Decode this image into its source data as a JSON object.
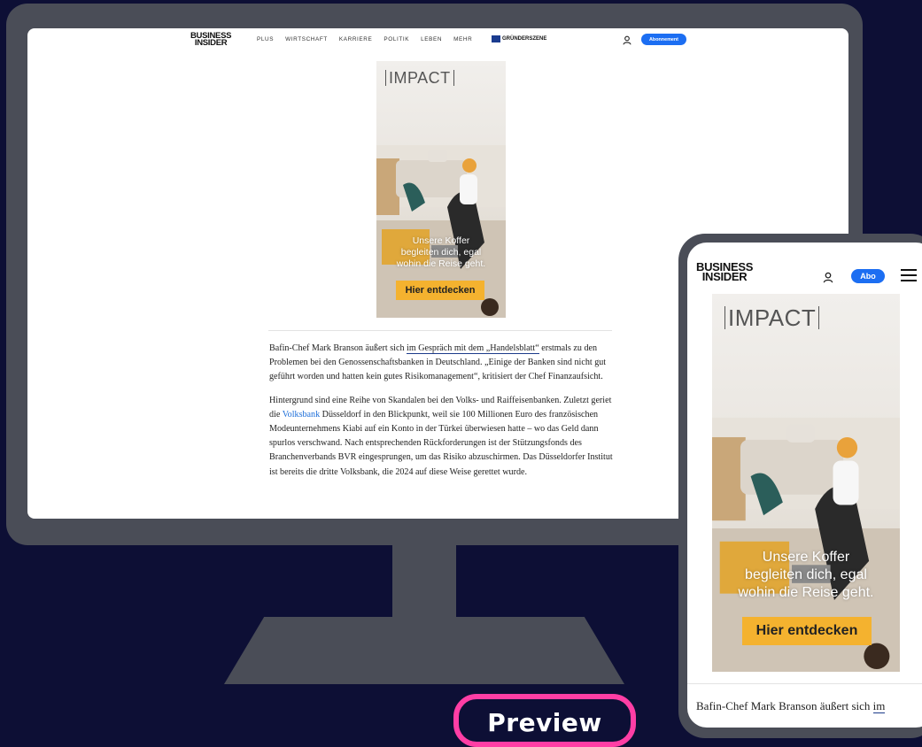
{
  "brand": {
    "logo_line1": "BUSINESS",
    "logo_line2": "INSIDER",
    "partner_logo": "GRÜNDERSZENE"
  },
  "nav": {
    "items": [
      {
        "label": "PLUS"
      },
      {
        "label": "WIRTSCHAFT"
      },
      {
        "label": "KARRIERE"
      },
      {
        "label": "POLITIK"
      },
      {
        "label": "LEBEN"
      },
      {
        "label": "MEHR"
      }
    ]
  },
  "header": {
    "subscribe_desktop": "Abonnement",
    "subscribe_mobile": "Abo",
    "user_icon": "user-icon",
    "menu_icon": "hamburger-menu-icon"
  },
  "ad": {
    "brand": "IMPACT",
    "copy_line1": "Unsere Koffer",
    "copy_line2": "begleiten dich, egal",
    "copy_line3": "wohin die Reise geht.",
    "cta": "Hier entdecken"
  },
  "article": {
    "p1_before": "Bafin-Chef Mark Branson äußert sich ",
    "p1_link": "im Gespräch mit dem „Handelsblatt“",
    "p1_after": " erstmals zu den Problemen bei den Genossenschaftsbanken in Deutschland. „Einige der Banken sind nicht gut geführt worden und hatten kein gutes Risikomanagement“, kritisiert der Chef Finanzaufsicht.",
    "p2_before": "Hintergrund sind eine Reihe von Skandalen bei den Volks- und Raiffeisenbanken. Zuletzt geriet die ",
    "p2_link": "Volksbank",
    "p2_after": " Düsseldorf in den Blickpunkt, weil sie 100 Millionen Euro des französischen Modeunternehmens Kiabi auf ein Konto in der Türkei überwiesen hatte – wo das Geld dann spurlos verschwand. Nach entsprechenden Rückforderungen ist der Stützungsfonds des Branchenverbands BVR eingesprungen, um das Risiko abzuschirmen. Das Düsseldorfer Institut ist bereits die dritte Volksbank, die 2024 auf diese Weise gerettet wurde.",
    "mobile_snippet": "Bafin-Chef Mark Branson äußert sich",
    "mobile_snippet_link": "im"
  },
  "preview_label": "Preview",
  "colors": {
    "background": "#0d0f35",
    "device_frame": "#4a4d57",
    "accent_blue": "#1c6ef2",
    "cta_yellow": "#f4b22f",
    "preview_pink": "#ff3ea5"
  }
}
